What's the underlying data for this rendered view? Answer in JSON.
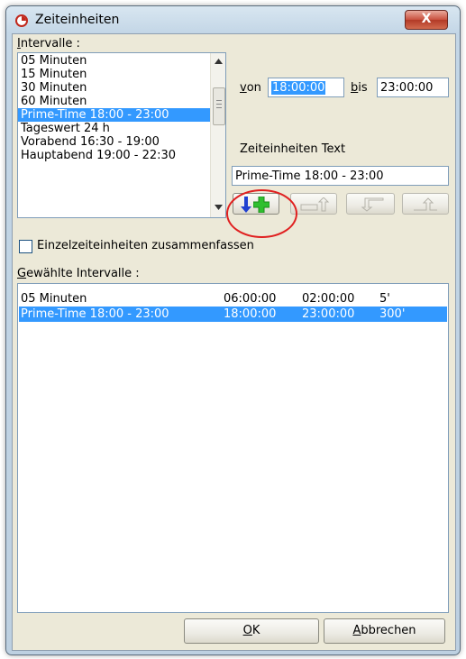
{
  "window": {
    "title": "Zeiteinheiten",
    "close_label": "X"
  },
  "intervals": {
    "label_first": "I",
    "label_rest": "ntervalle :",
    "items": [
      "05 Minuten",
      "15 Minuten",
      "30 Minuten",
      "60 Minuten",
      "Prime-Time 18:00 - 23:00",
      "Tageswert 24 h",
      "Vorabend 16:30 - 19:00",
      "Hauptabend 19:00 - 22:30"
    ],
    "selected_index": 4
  },
  "time_range": {
    "von_first": "v",
    "von_rest": "on",
    "von_value": "18:00:00",
    "bis_first": "b",
    "bis_rest": "is",
    "bis_value": "23:00:00"
  },
  "text_field": {
    "label": "Zeiteinheiten Text",
    "value": "Prime-Time 18:00 - 23:00"
  },
  "checkbox": {
    "label": "Einzelzeiteinheiten zusammenfassen",
    "checked": false
  },
  "selected_intervals": {
    "label_first": "G",
    "label_rest": "ewählte Intervalle :",
    "rows": [
      {
        "name": "05 Minuten",
        "start": "06:00:00",
        "end": "02:00:00",
        "dur": "5'"
      },
      {
        "name": "Prime-Time 18:00 - 23:00",
        "start": "18:00:00",
        "end": "23:00:00",
        "dur": "300'"
      }
    ],
    "selected_index": 1
  },
  "buttons": {
    "ok_first": "O",
    "ok_rest": "K",
    "cancel_first": "A",
    "cancel_rest": "bbrechen"
  },
  "colors": {
    "selection": "#3399ff",
    "annotation": "#e02020",
    "plus": "#2fbf2f",
    "arrow": "#2040d0"
  }
}
